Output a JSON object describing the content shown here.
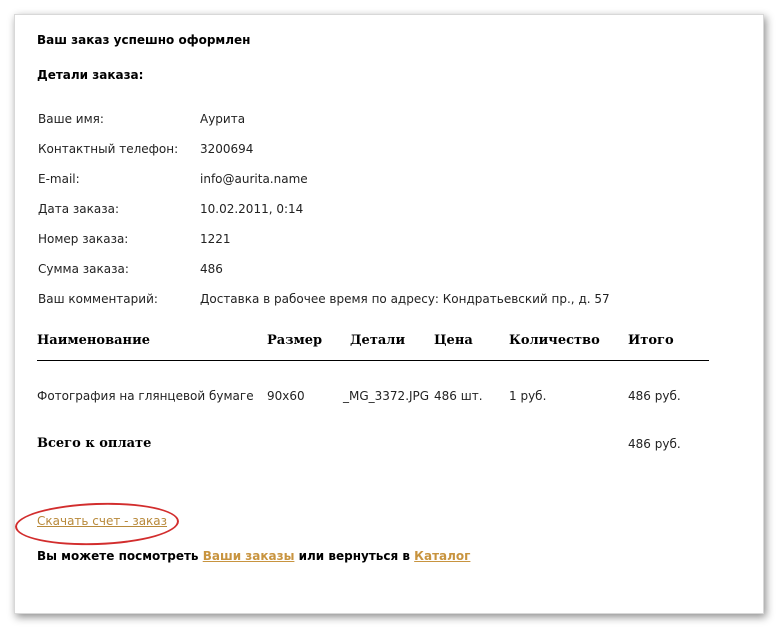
{
  "header": {
    "title": "Ваш заказ успешно оформлен",
    "details_heading": "Детали заказа:"
  },
  "details": [
    {
      "label": "Ваше имя:",
      "value": "Аурита"
    },
    {
      "label": "Контактный телефон:",
      "value": "3200694"
    },
    {
      "label": "E-mail:",
      "value": "info@aurita.name"
    },
    {
      "label": "Дата заказа:",
      "value": "10.02.2011, 0:14"
    },
    {
      "label": "Номер заказа:",
      "value": "1221"
    },
    {
      "label": "Сумма заказа:",
      "value": "486"
    },
    {
      "label": "Ваш комментарий:",
      "value": "Доставка в рабочее время по адресу: Кондратьевский пр., д. 57"
    }
  ],
  "table": {
    "columns": [
      "Наименование",
      "Размер",
      "Детали",
      "Цена",
      "Количество",
      "Итого"
    ],
    "rows": [
      [
        "Фотография на глянцевой бумаге",
        "90x60",
        "_MG_3372.JPG",
        "486 шт.",
        "1 руб.",
        "486 руб."
      ]
    ],
    "total_label": "Всего к оплате",
    "total_value": "486 руб."
  },
  "footer": {
    "download_link": "Скачать счет - заказ",
    "prefix": "Вы можете посмотреть",
    "orders_link": "Ваши заказы",
    "middle": "или вернуться в",
    "catalog_link": "Каталог"
  },
  "colors": {
    "link": "#b8893a",
    "highlight_ellipse": "#d22d2d"
  }
}
